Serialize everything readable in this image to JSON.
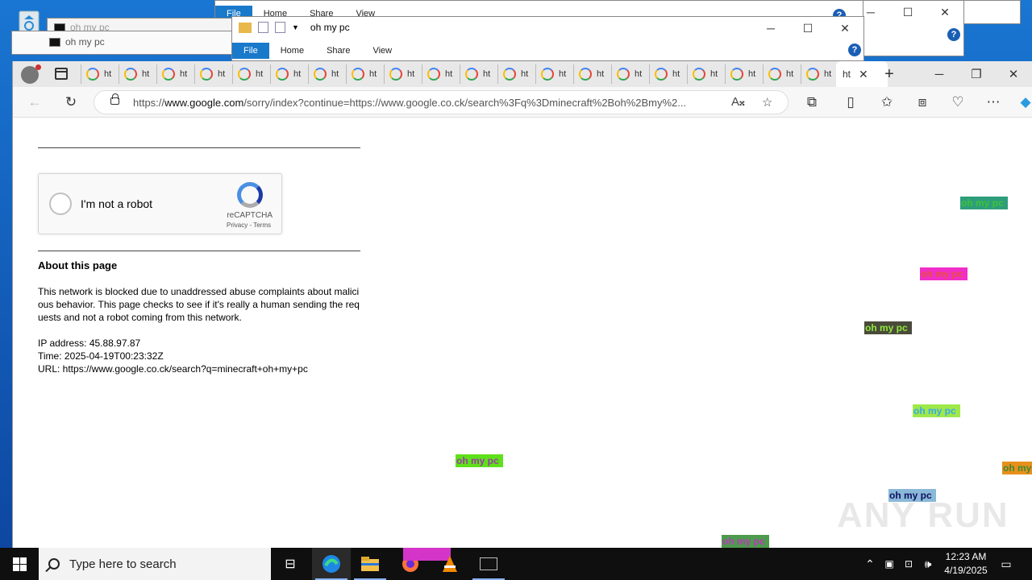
{
  "background_windows": {
    "explorer_back": {
      "tabs": [
        "File",
        "Home",
        "Share",
        "View"
      ]
    },
    "explorer_front": {
      "title": "oh my pc",
      "tabs": [
        "File",
        "Home",
        "Share",
        "View"
      ]
    },
    "cmd_back": {
      "title": "oh my pc"
    },
    "cmd_front": {
      "title": "oh my pc"
    }
  },
  "browser": {
    "tab_label": "ht",
    "tab_count_inactive": 21,
    "active_tab_label": "ht",
    "address": {
      "scheme": "https://",
      "host": "www.google.com",
      "path": "/sorry/index?continue=https://www.google.co.ck/search%3Fq%3Dminecraft%2Boh%2Bmy%2..."
    }
  },
  "page": {
    "captcha": {
      "label": "I'm not a robot",
      "brand": "reCAPTCHA",
      "links": "Privacy - Terms"
    },
    "about_heading": "About this page",
    "about_text": "This network is blocked due to unaddressed abuse complaints about malicious behavior. This page checks to see if it's really a human sending the requests and not a robot coming from this network.",
    "ip_line": "IP address: 45.88.97.87",
    "time_line": "Time: 2025-04-19T00:23:32Z",
    "url_line": "URL: https://www.google.co.ck/search?q=minecraft+oh+my+pc"
  },
  "popups": [
    {
      "text": "oh my pc",
      "bg": "#2e9e7a",
      "fg": "#3cc23c"
    },
    {
      "text": "oh my pc",
      "bg": "#f02ec8",
      "fg": "#e8503a"
    },
    {
      "text": "oh my pc",
      "bg": "#4a4a3a",
      "fg": "#8ee83a"
    },
    {
      "text": "oh my pc",
      "bg": "#9ee84a",
      "fg": "#3aa8e8"
    },
    {
      "text": "oh my pc",
      "bg": "#5ee01a",
      "fg": "#9a3aa8"
    },
    {
      "text": "oh my",
      "bg": "#e8901a",
      "fg": "#3a8a3a"
    },
    {
      "text": "oh my pc",
      "bg": "#8ab8d8",
      "fg": "#101060"
    },
    {
      "text": "oh my pc",
      "bg": "#4e9a4e",
      "fg": "#b83ab8"
    }
  ],
  "watermark": "ANY RUN",
  "taskbar": {
    "search_placeholder": "Type here to search",
    "time": "12:23 AM",
    "date": "4/19/2025"
  },
  "colors": {
    "desktop": "#1976d2",
    "accent": "#1979ca",
    "taskbar": "#0f0f0f"
  }
}
